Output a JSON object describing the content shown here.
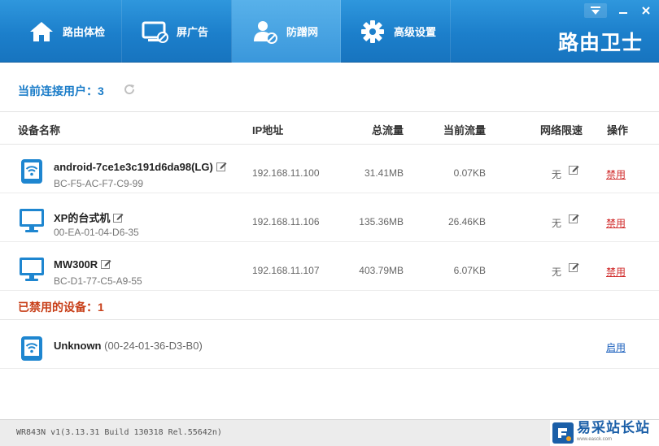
{
  "nav": {
    "tabs": [
      {
        "label": "路由体检",
        "icon": "home-icon"
      },
      {
        "label": "屏广告",
        "icon": "monitor-block-icon"
      },
      {
        "label": "防蹭网",
        "icon": "user-shield-icon",
        "active": true
      },
      {
        "label": "高级设置",
        "icon": "gear-icon"
      }
    ],
    "brand": "路由卫士"
  },
  "connected": {
    "title": "当前连接用户：3"
  },
  "table": {
    "headers": {
      "name": "设备名称",
      "ip": "IP地址",
      "total": "总流量",
      "current": "当前流量",
      "limit": "网络限速",
      "action": "操作"
    }
  },
  "devices": [
    {
      "type": "tablet-wifi-icon",
      "name": "android-7ce1e3c191d6da98(LG)",
      "mac": "BC-F5-AC-F7-C9-99",
      "ip": "192.168.11.100",
      "total": "31.41MB",
      "current": "0.07KB",
      "limit": "无",
      "action": "禁用"
    },
    {
      "type": "desktop-monitor-icon",
      "name": "XP的台式机",
      "mac": "00-EA-01-04-D6-35",
      "ip": "192.168.11.106",
      "total": "135.36MB",
      "current": "26.46KB",
      "limit": "无",
      "action": "禁用"
    },
    {
      "type": "desktop-monitor-icon",
      "name": "MW300R",
      "mac": "BC-D1-77-C5-A9-55",
      "ip": "192.168.11.107",
      "total": "403.79MB",
      "current": "6.07KB",
      "limit": "无",
      "action": "禁用"
    }
  ],
  "banned": {
    "title": "已禁用的设备：1",
    "devices": [
      {
        "type": "tablet-wifi-icon",
        "name": "Unknown",
        "mac": "(00-24-01-36-D3-B0)",
        "action": "启用"
      }
    ]
  },
  "status": {
    "version": "WR843N v1(3.13.31 Build 130318 Rel.55642n)"
  },
  "watermark": {
    "title": "易采站长站",
    "url": "www.easck.com"
  },
  "colors": {
    "topbar": "#1c7fcb",
    "active_tab": "#3a97db",
    "section_title": "#1a7cc8",
    "banned_title": "#c8401a",
    "ban_link": "#d02a2a",
    "enable_link": "#1a5fbd"
  }
}
